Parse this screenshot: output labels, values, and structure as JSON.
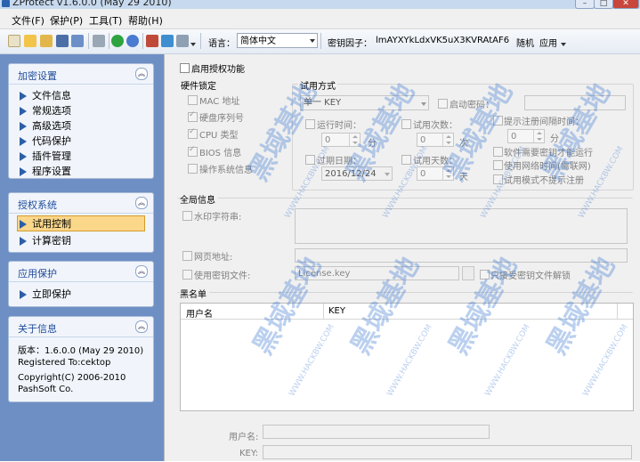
{
  "window": {
    "title": "ZProtect v1.6.0.0 (May 29 2010)"
  },
  "menu": [
    "文件(F)",
    "保护(P)",
    "工具(T)",
    "帮助(H)"
  ],
  "toolbar": {
    "language_label": "语言：",
    "language_value": "简体中文",
    "key_factor_label": "密钥因子：",
    "key_factor_value": "lmAYXYkLdxVK5uX3KVRAtAF6",
    "random_label": "随机",
    "apply_label": "应用"
  },
  "sidebar": {
    "encrypt_settings": {
      "title": "加密设置",
      "items": [
        "文件信息",
        "常规选项",
        "高级选项",
        "代码保护",
        "插件管理",
        "程序设置"
      ]
    },
    "license_system": {
      "title": "授权系统",
      "items": [
        "试用控制",
        "计算密钥"
      ],
      "selected": "试用控制"
    },
    "app_protect": {
      "title": "应用保护",
      "items": [
        "立即保护"
      ]
    },
    "about": {
      "title": "关于信息",
      "version": "版本：1.6.0.0 (May 29 2010)",
      "registered": "Registered To:cektop",
      "copyright": "Copyright(C) 2006-2010",
      "company": "PashSoft Co."
    }
  },
  "main": {
    "enable_license": "启用授权功能",
    "hw_lock": {
      "title": "硬件锁定",
      "options": [
        {
          "label": "MAC 地址",
          "checked": false
        },
        {
          "label": "硬盘序列号",
          "checked": true
        },
        {
          "label": "CPU 类型",
          "checked": true
        },
        {
          "label": "BIOS 信息",
          "checked": true
        },
        {
          "label": "操作系统信息",
          "checked": false
        }
      ]
    },
    "trial": {
      "title": "试用方式",
      "mode_value": "单一 KEY",
      "startup_password": "启动密码：",
      "run_time": "运行时间：",
      "run_time_value": "0",
      "run_time_unit": "分",
      "trial_count": "试用次数：",
      "trial_count_value": "0",
      "trial_count_unit": "次",
      "expire_date": "过期日期：",
      "expire_date_value": "2016/12/24",
      "trial_days": "试用天数：",
      "trial_days_value": "0",
      "trial_days_unit": "天",
      "reminder_interval": "提示注册间隔时间：",
      "reminder_value": "0",
      "reminder_unit": "分",
      "need_key": "软件需要密钥才能运行",
      "use_net_time": "使用网络时间(需联网)",
      "no_prompt": "试用模式不提示注册"
    },
    "global": {
      "title": "全局信息",
      "watermark": "水印字符串:",
      "webpage": "网页地址:",
      "key_file": "使用密钥文件:",
      "key_file_value": "License.key",
      "only_accept": "只接受密钥文件解锁"
    },
    "blacklist": {
      "title": "黑名单",
      "columns": [
        "用户名",
        "KEY"
      ],
      "username_label": "用户名:",
      "key_label": "KEY:"
    }
  },
  "watermark_text": {
    "large": "黑域基地",
    "small": "WWW.HACKBW.COM"
  }
}
